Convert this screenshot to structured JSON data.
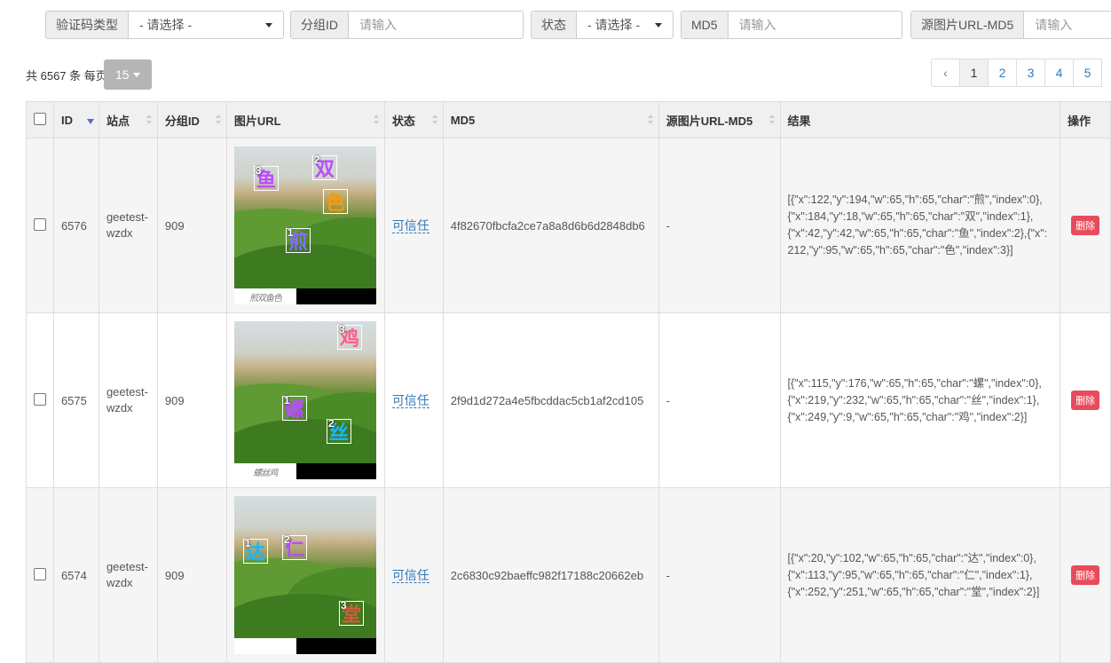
{
  "filters": [
    {
      "label": "验证码类型",
      "value": "- 请选择 -",
      "kind": "select"
    },
    {
      "label": "分组ID",
      "placeholder": "请输入",
      "kind": "input"
    },
    {
      "label": "状态",
      "value": "- 请选择 -",
      "kind": "select"
    },
    {
      "label": "MD5",
      "placeholder": "请输入",
      "kind": "input"
    },
    {
      "label": "源图片URL-MD5",
      "placeholder": "请输入",
      "kind": "input"
    }
  ],
  "summary": {
    "text": "共 6567 条 每页",
    "page_size": "15"
  },
  "pagination": {
    "prev": "‹",
    "pages": [
      "1",
      "2",
      "3",
      "4",
      "5"
    ],
    "current": "1"
  },
  "table": {
    "headers": [
      "ID",
      "站点",
      "分组ID",
      "图片URL",
      "状态",
      "MD5",
      "源图片URL-MD5",
      "结果",
      "操作"
    ],
    "sort_column": "ID",
    "sort_direction": "desc",
    "rows": [
      {
        "id": "6576",
        "site": "geetest-wzdx",
        "group_id": "909",
        "status": "可信任",
        "md5": "4f82670fbcfa2ce7a8a8d6b6d2848db6",
        "src_md5": "-",
        "result": "[{\"x\":122,\"y\":194,\"w\":65,\"h\":65,\"char\":\"煎\",\"index\":0},{\"x\":184,\"y\":18,\"w\":65,\"h\":65,\"char\":\"双\",\"index\":1},{\"x\":42,\"y\":42,\"w\":65,\"h\":65,\"char\":\"鱼\",\"index\":2},{\"x\":212,\"y\":95,\"w\":65,\"h\":65,\"char\":\"色\",\"index\":3}]",
        "action": "删除",
        "captcha": {
          "hint": "煎双鱼色",
          "marks": [
            {
              "num": "3",
              "ch": "鱼",
              "color": "#b84dff"
            },
            {
              "num": "2",
              "ch": "双",
              "color": "#b84dff"
            },
            {
              "num": "",
              "ch": "色",
              "color": "#ff9900"
            },
            {
              "num": "1",
              "ch": "煎",
              "color": "#8a6cff"
            }
          ]
        }
      },
      {
        "id": "6575",
        "site": "geetest-wzdx",
        "group_id": "909",
        "status": "可信任",
        "md5": "2f9d1d272a4e5fbcddac5cb1af2cd105",
        "src_md5": "-",
        "result": "[{\"x\":115,\"y\":176,\"w\":65,\"h\":65,\"char\":\"螺\",\"index\":0},{\"x\":219,\"y\":232,\"w\":65,\"h\":65,\"char\":\"丝\",\"index\":1},{\"x\":249,\"y\":9,\"w\":65,\"h\":65,\"char\":\"鸡\",\"index\":2}]",
        "action": "删除",
        "captcha": {
          "hint": "螺丝鸡",
          "marks": [
            {
              "num": "3",
              "ch": "鸡",
              "color": "#ff5c8a"
            },
            {
              "num": "1",
              "ch": "螺",
              "color": "#b84dff"
            },
            {
              "num": "2",
              "ch": "丝",
              "color": "#19b7ff"
            }
          ]
        }
      },
      {
        "id": "6574",
        "site": "geetest-wzdx",
        "group_id": "909",
        "status": "可信任",
        "md5": "2c6830c92baeffc982f17188c20662eb",
        "src_md5": "-",
        "result": "[{\"x\":20,\"y\":102,\"w\":65,\"h\":65,\"char\":\"达\",\"index\":0},{\"x\":113,\"y\":95,\"w\":65,\"h\":65,\"char\":\"仁\",\"index\":1},{\"x\":252,\"y\":251,\"w\":65,\"h\":65,\"char\":\"堂\",\"index\":2}]",
        "action": "删除",
        "captcha": {
          "hint": "",
          "marks": [
            {
              "num": "1",
              "ch": "达",
              "color": "#19b7ff"
            },
            {
              "num": "2",
              "ch": "仁",
              "color": "#b84dff"
            },
            {
              "num": "3",
              "ch": "堂",
              "color": "#e0553a"
            }
          ]
        }
      }
    ]
  }
}
